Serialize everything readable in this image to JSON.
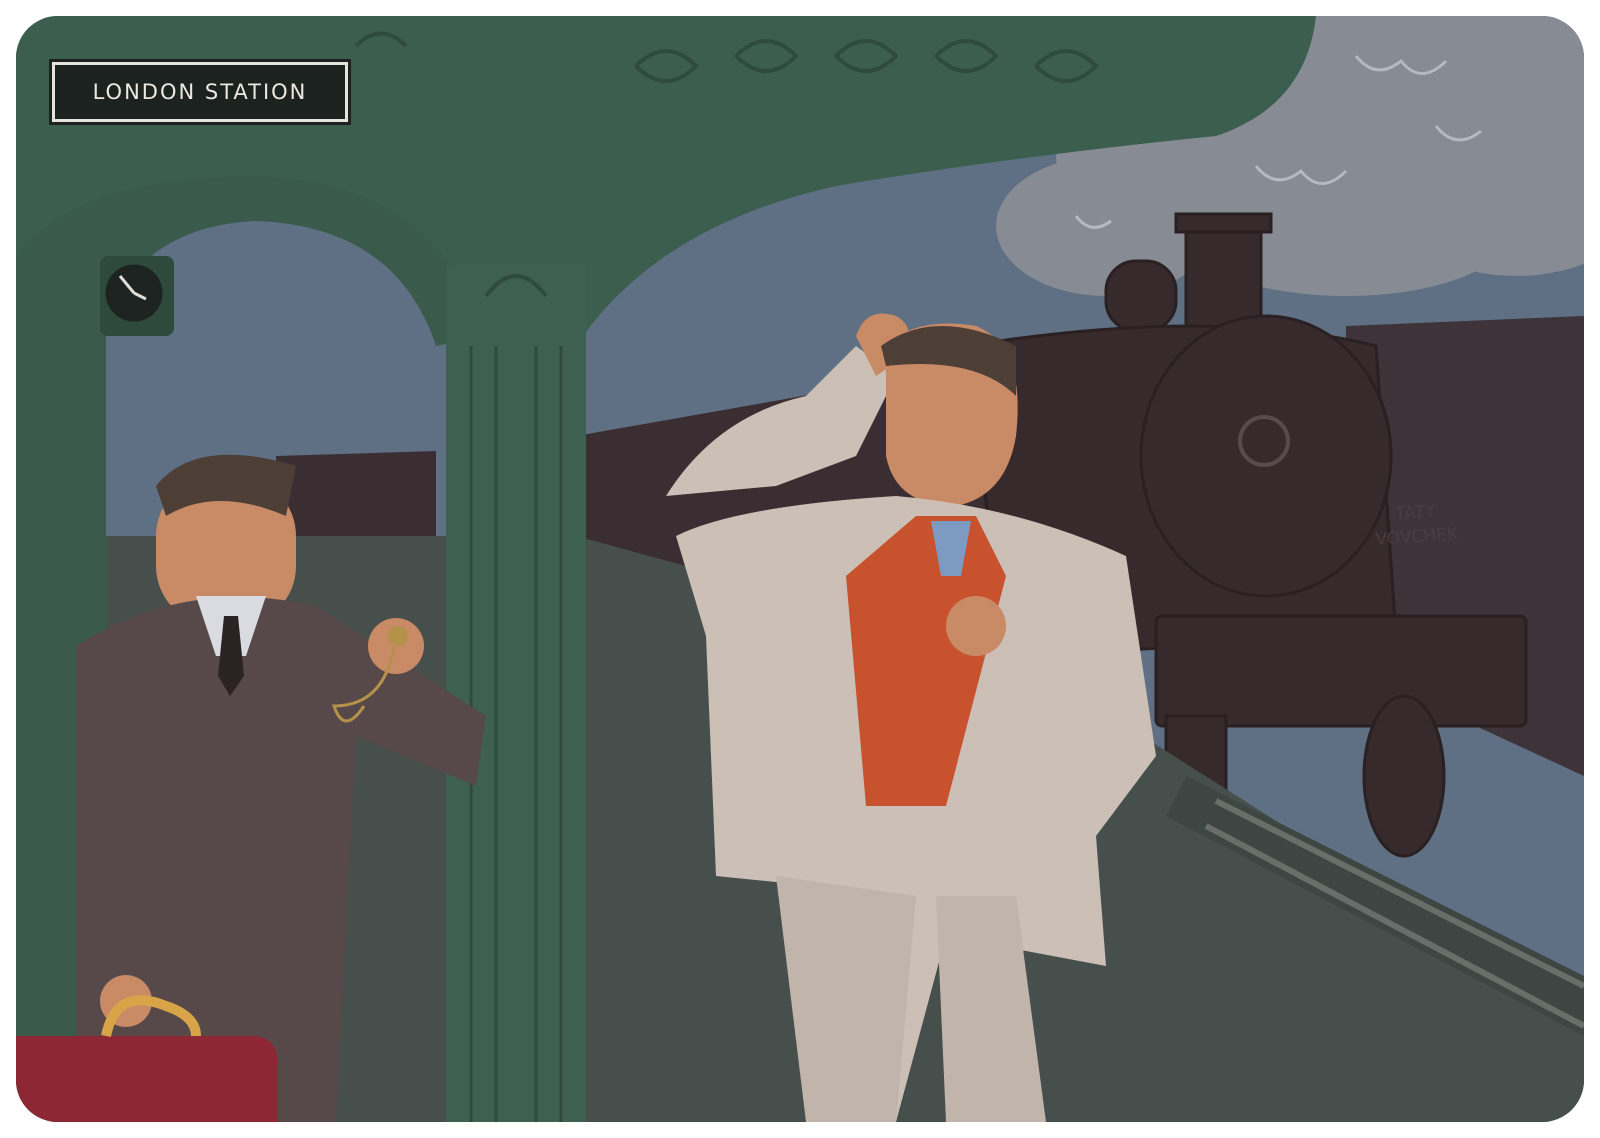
{
  "sign": {
    "text": "LONDON STATION"
  },
  "signature": {
    "line1": "TATY",
    "line2": "VOVCHEK"
  },
  "colors": {
    "sky": "#5f7084",
    "smoke": "#868a92",
    "pavilion_green": "#3b5e4e",
    "platform": "#48504d",
    "locomotive": "#3a2b2d",
    "white_suit": "#cbbfb6",
    "red_vest": "#c9522e",
    "brown_suit": "#5a4d48",
    "bag_red": "#8c2733"
  },
  "icons": [
    "clock-icon"
  ]
}
